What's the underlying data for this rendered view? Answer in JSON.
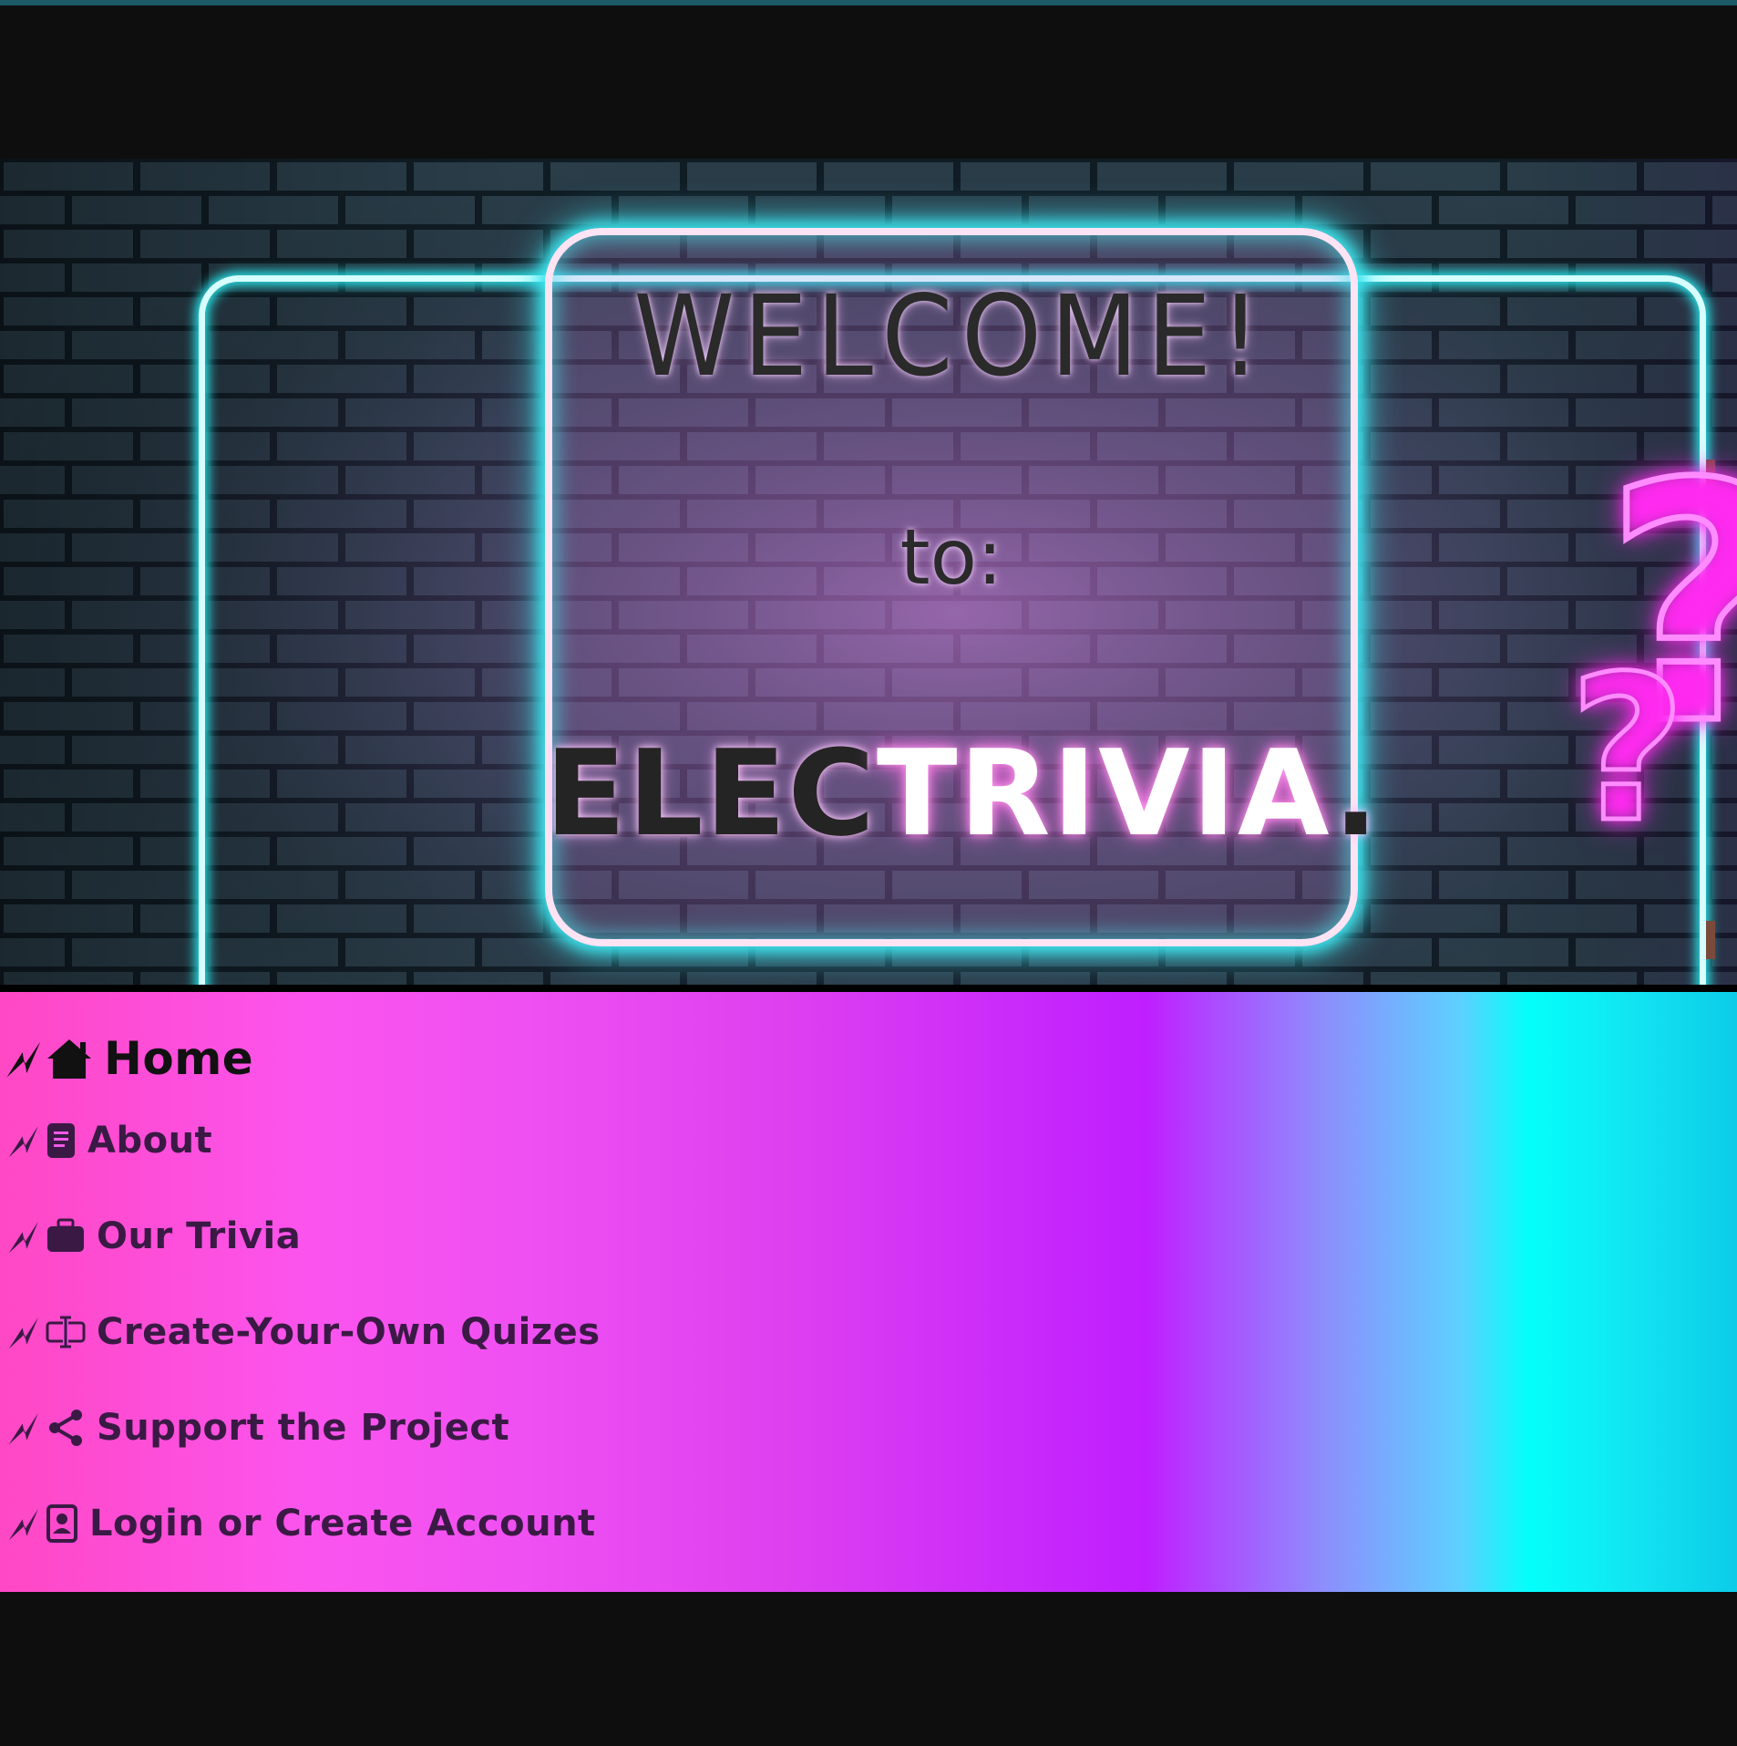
{
  "hero": {
    "welcome": "WELCOME!",
    "to": "to:",
    "brand_dark": "ELEC",
    "brand_light": "TRIVIA",
    "brand_dot": "."
  },
  "nav": {
    "items": [
      {
        "label": "Home",
        "icon": "home-icon",
        "active": true
      },
      {
        "label": "About",
        "icon": "document-icon"
      },
      {
        "label": "Our Trivia",
        "icon": "briefcase-icon"
      },
      {
        "label": "Create-Your-Own Quizes",
        "icon": "text-cursor-icon"
      },
      {
        "label": "Support the Project",
        "icon": "share-icon"
      },
      {
        "label": "Login or Create Account",
        "icon": "contact-icon"
      }
    ]
  },
  "colors": {
    "page_bg": "#0e0e0e",
    "neon_cyan": "#27e8ec",
    "neon_pink": "#ff2bf0",
    "nav_pink": "#ff48c4",
    "nav_purple": "#bf1eff",
    "nav_cyan": "#04fffa"
  }
}
